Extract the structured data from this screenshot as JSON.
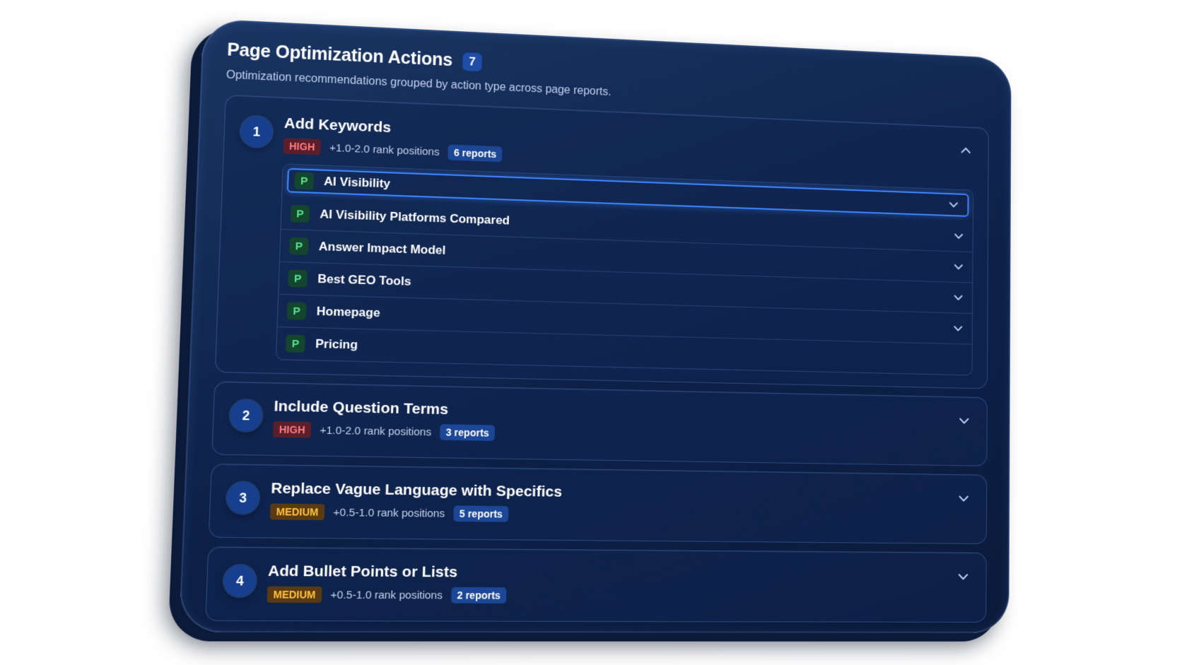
{
  "panel": {
    "title": "Page Optimization Actions",
    "count": "7",
    "subtitle": "Optimization recommendations grouped by action type across page reports."
  },
  "groups": [
    {
      "number": "1",
      "title": "Add Keywords",
      "priority": "HIGH",
      "impact": "+1.0-2.0 rank positions",
      "reports": "6 reports",
      "expanded": true,
      "pages": [
        {
          "badge": "P",
          "name": "AI Visibility",
          "selected": true
        },
        {
          "badge": "P",
          "name": "AI Visibility Platforms Compared"
        },
        {
          "badge": "P",
          "name": "Answer Impact Model"
        },
        {
          "badge": "P",
          "name": "Best GEO Tools"
        },
        {
          "badge": "P",
          "name": "Homepage"
        },
        {
          "badge": "P",
          "name": "Pricing"
        }
      ]
    },
    {
      "number": "2",
      "title": "Include Question Terms",
      "priority": "HIGH",
      "impact": "+1.0-2.0 rank positions",
      "reports": "3 reports",
      "expanded": false
    },
    {
      "number": "3",
      "title": "Replace Vague Language with Specifics",
      "priority": "MEDIUM",
      "impact": "+0.5-1.0 rank positions",
      "reports": "5 reports",
      "expanded": false
    },
    {
      "number": "4",
      "title": "Add Bullet Points or Lists",
      "priority": "MEDIUM",
      "impact": "+0.5-1.0 rank positions",
      "reports": "2 reports",
      "expanded": false
    }
  ],
  "icons": {
    "collapse": "chevron-up-icon",
    "expand": "chevron-down-icon"
  },
  "colors": {
    "background": "#0d2148",
    "accent": "#3e86ff",
    "high": "#ff7b82",
    "medium": "#ffc23d",
    "page_badge": "#57e08a"
  }
}
